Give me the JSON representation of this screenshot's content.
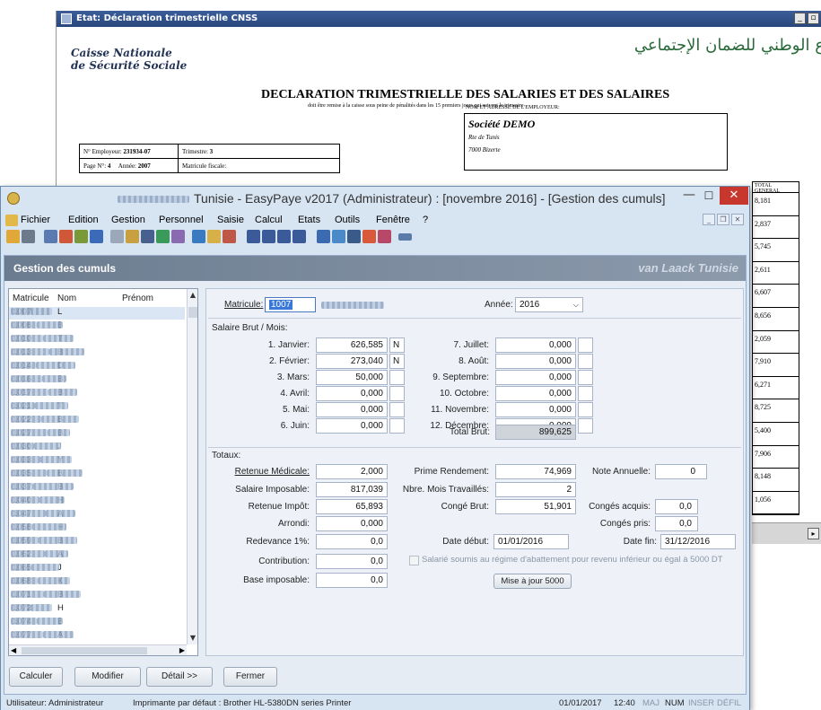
{
  "report": {
    "title": "Etat: Déclaration trimestrielle CNSS",
    "logo_line1": "Caisse Nationale",
    "logo_line2": "de Sécurité Sociale",
    "arabic_text": "ع الوطني للضمان الإجتماعي",
    "heading": "DECLARATION TRIMESTRIELLE DES SALARIES ET DES SALAIRES",
    "subheading": "doit être remise à la caisse sous peine de pénalités dans les 15 premiers jours qui suivent le trimestre",
    "employer_label": "NOM ET ADRESSE DE L'EMPLOYEUR:",
    "employer_name": "Société DEMO",
    "employer_line1": "Rte de Tunis",
    "employer_line2": "7000 Bizerte",
    "employer_no_label": "N° Employeur:",
    "employer_no": "231934-07",
    "trimestre_label": "Trimestre:",
    "trimestre": "3",
    "page_label": "Page N°:",
    "page": "4",
    "annee_label": "Année:",
    "annee": "2007",
    "matricule_fiscale_label": "Matricule fiscale:",
    "right_col_header": "TOTAL GENERAL",
    "right_col_values": [
      "8,181",
      "2,837",
      "5,745",
      "2,611",
      "6,607",
      "8,656",
      "2,059",
      "7,910",
      "6,271",
      "8,725",
      "5,400",
      "7,906",
      "8,148",
      "1,056"
    ]
  },
  "window": {
    "title_prefix": "Tunisie - EasyPaye v2017 (Administrateur) : [novembre 2016] - [Gestion des cumuls]",
    "min": "—",
    "max": "☐",
    "close": "✕"
  },
  "menu": {
    "items": [
      "Fichier",
      "Edition",
      "Gestion",
      "Personnel",
      "Saisie",
      "Calcul",
      "Etats",
      "Outils",
      "Fenêtre",
      "?"
    ]
  },
  "panel": {
    "title": "Gestion des cumuls",
    "brand": "van Laack Tunisie"
  },
  "list": {
    "headers": {
      "matricule": "Matricule",
      "nom": "Nom",
      "prenom": "Prénom"
    },
    "rows": [
      {
        "m": "1007",
        "n": "L",
        "p": ""
      },
      {
        "m": "1008",
        "n": "B",
        "p": ""
      },
      {
        "m": "1010",
        "n": "T",
        "p": ""
      },
      {
        "m": "1013",
        "n": "B",
        "p": ""
      },
      {
        "m": "1014",
        "n": "D",
        "p": ""
      },
      {
        "m": "1016",
        "n": "B",
        "p": ""
      },
      {
        "m": "1017",
        "n": "B",
        "p": ""
      },
      {
        "m": "1021",
        "n": "T",
        "p": ""
      },
      {
        "m": "1022",
        "n": "B",
        "p": ""
      },
      {
        "m": "1027",
        "n": "B",
        "p": ""
      },
      {
        "m": "1030",
        "n": "J",
        "p": ""
      },
      {
        "m": "1033",
        "n": "Y",
        "p": ""
      },
      {
        "m": "1035",
        "n": "B",
        "p": ""
      },
      {
        "m": "1037",
        "n": "B",
        "p": ""
      },
      {
        "m": "1040",
        "n": "H",
        "p": ""
      },
      {
        "m": "1047",
        "n": "A",
        "p": ""
      },
      {
        "m": "1058",
        "n": "H",
        "p": ""
      },
      {
        "m": "1059",
        "n": "B",
        "p": ""
      },
      {
        "m": "1062",
        "n": "A",
        "p": ""
      },
      {
        "m": "1065",
        "n": "J",
        "p": ""
      },
      {
        "m": "1068",
        "n": "K",
        "p": ""
      },
      {
        "m": "1071",
        "n": "B",
        "p": ""
      },
      {
        "m": "1072",
        "n": "H",
        "p": ""
      },
      {
        "m": "1074",
        "n": "B",
        "p": ""
      },
      {
        "m": "1077",
        "n": "A",
        "p": ""
      }
    ]
  },
  "form": {
    "matricule_label": "Matricule:",
    "matricule_value": "1007",
    "annee_label": "Année:",
    "annee_value": "2016",
    "salaire_section": "Salaire Brut / Mois:",
    "months_left": [
      {
        "label": "1. Janvier:",
        "value": "626,585",
        "flag": "N"
      },
      {
        "label": "2. Février:",
        "value": "273,040",
        "flag": "N"
      },
      {
        "label": "3. Mars:",
        "value": "50,000",
        "flag": ""
      },
      {
        "label": "4. Avril:",
        "value": "0,000",
        "flag": ""
      },
      {
        "label": "5. Mai:",
        "value": "0,000",
        "flag": ""
      },
      {
        "label": "6. Juin:",
        "value": "0,000",
        "flag": ""
      }
    ],
    "months_right": [
      {
        "label": "7. Juillet:",
        "value": "0,000"
      },
      {
        "label": "8. Août:",
        "value": "0,000"
      },
      {
        "label": "9. Septembre:",
        "value": "0,000"
      },
      {
        "label": "10. Octobre:",
        "value": "0,000"
      },
      {
        "label": "11. Novembre:",
        "value": "0,000"
      },
      {
        "label": "12. Décembre:",
        "value": "0,000"
      }
    ],
    "total_brut_label": "Total Brut:",
    "total_brut_value": "899,625",
    "totaux_section": "Totaux:",
    "retenue_medicale_label": "Retenue Médicale:",
    "retenue_medicale_value": "2,000",
    "salaire_imposable_label": "Salaire Imposable:",
    "salaire_imposable_value": "817,039",
    "retenue_impot_label": "Retenue Impôt:",
    "retenue_impot_value": "65,893",
    "arrondi_label": "Arrondi:",
    "arrondi_value": "0,000",
    "redevance_label": "Redevance 1%:",
    "redevance_value": "0,0",
    "contribution_label": "Contribution:",
    "contribution_value": "0,0",
    "base_imposable_label": "Base imposable:",
    "base_imposable_value": "0,0",
    "prime_rendement_label": "Prime Rendement:",
    "prime_rendement_value": "74,969",
    "nbre_mois_label": "Nbre. Mois Travaillés:",
    "nbre_mois_value": "2",
    "conge_brut_label": "Congé Brut:",
    "conge_brut_value": "51,901",
    "note_annuelle_label": "Note Annuelle:",
    "note_annuelle_value": "0",
    "conges_acquis_label": "Congés acquis:",
    "conges_acquis_value": "0,0",
    "conges_pris_label": "Congés pris:",
    "conges_pris_value": "0,0",
    "date_debut_label": "Date début:",
    "date_debut_value": "01/01/2016",
    "date_fin_label": "Date fin:",
    "date_fin_value": "31/12/2016",
    "abattement_label": "Salarié soumis au régime d'abattement pour revenu inférieur ou égal à 5000 DT",
    "mise_a_jour_label": "Mise à jour 5000"
  },
  "buttons": {
    "calculer": "Calculer",
    "modifier": "Modifier",
    "detail": "Détail >>",
    "fermer": "Fermer"
  },
  "status": {
    "user": "Utilisateur: Administrateur",
    "printer": "Imprimante par défaut : Brother HL-5380DN series Printer",
    "date": "01/01/2017",
    "time": "12:40",
    "maj": "MAJ",
    "num": "NUM",
    "inser": "INSER",
    "defil": "DÉFIL"
  }
}
